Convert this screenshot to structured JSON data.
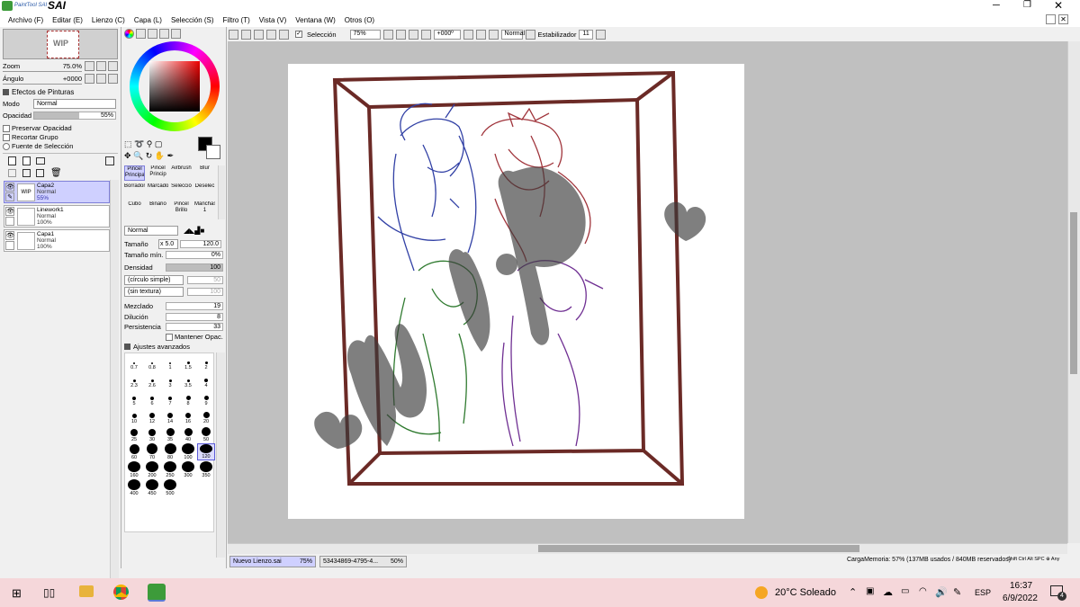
{
  "app": {
    "title": "SAI",
    "logo_text": "PaintTool SAI"
  },
  "menu": [
    "Archivo (F)",
    "Editar (E)",
    "Lienzo (C)",
    "Capa (L)",
    "Selección (S)",
    "Filtro (T)",
    "Vista (V)",
    "Ventana (W)",
    "Otros (O)"
  ],
  "toolbar": {
    "selection_label": "Selección",
    "zoom": "75%",
    "angle": "+000º",
    "blend": "Normal",
    "stabilizer_label": "Estabilizador",
    "stabilizer_value": "11"
  },
  "navigator": {
    "zoom_label": "Zoom",
    "zoom_value": "75.0%",
    "angle_label": "Ángulo",
    "angle_value": "+0000"
  },
  "paint_effects": {
    "header": "Efectos de Pinturas",
    "mode_label": "Modo",
    "mode_value": "Normal",
    "opacity_label": "Opacidad",
    "opacity_value": "55%",
    "opacity_fraction": 0.55,
    "preserve": "Preservar Opacidad",
    "clip": "Recortar Grupo",
    "source": "Fuente de Selección"
  },
  "layers": [
    {
      "name": "Capa2",
      "mode": "Normal",
      "opacity": "55%",
      "selected": true
    },
    {
      "name": "Linework1",
      "mode": "Normal",
      "opacity": "100%",
      "selected": false
    },
    {
      "name": "Capa1",
      "mode": "Normal",
      "opacity": "100%",
      "selected": false
    }
  ],
  "tools": [
    {
      "label": "Pincel Principal",
      "selected": true
    },
    {
      "label": "Pincel Princip",
      "selected": false
    },
    {
      "label": "Airbrush",
      "selected": false
    },
    {
      "label": "Blur",
      "selected": false
    },
    {
      "label": "Borrador",
      "selected": false
    },
    {
      "label": "Marcador",
      "selected": false
    },
    {
      "label": "Selecció",
      "selected": false
    },
    {
      "label": "Deselec",
      "selected": false
    },
    {
      "label": "Cubo",
      "selected": false
    },
    {
      "label": "Binario",
      "selected": false
    },
    {
      "label": "Pincel Brillo",
      "selected": false
    },
    {
      "label": "Manchas 1",
      "selected": false
    }
  ],
  "brush": {
    "mode": "Normal",
    "size_label": "Tamaño",
    "size_mult": "x 5.0",
    "size_value": "120.0",
    "min_size_label": "Tamaño mín.",
    "min_size_value": "0%",
    "density_label": "Densidad",
    "density_value": "100",
    "shape": "(círculo simple)",
    "shape_value": "50",
    "texture": "(sin textura)",
    "texture_value": "100",
    "mix_label": "Mezclado",
    "mix_value": "19",
    "dilution_label": "Dilución",
    "dilution_value": "8",
    "persistence_label": "Persistencia",
    "persistence_value": "33",
    "keep_opacity": "Mantener Opac.",
    "advanced": "Ajustes avanzados",
    "sizes": [
      "0.7",
      "0.8",
      "1",
      "1.5",
      "2",
      "2.3",
      "2.6",
      "3",
      "3.5",
      "4",
      "5",
      "6",
      "7",
      "8",
      "9",
      "10",
      "12",
      "14",
      "16",
      "20",
      "25",
      "30",
      "35",
      "40",
      "50",
      "60",
      "70",
      "80",
      "100",
      "120",
      "160",
      "200",
      "250",
      "300",
      "350",
      "400",
      "450",
      "500"
    ],
    "selected_size": "120"
  },
  "tabs": [
    {
      "name": "Nuevo Lienzo.sai",
      "zoom": "75%",
      "active": true
    },
    {
      "name": "53434869-4795-4...",
      "zoom": "50%",
      "active": false
    }
  ],
  "status": {
    "memory": "CargaMemoria: 57% (137MB usados / 840MB reservados)",
    "keys": "Shift Ctrl Alt SPC ⊕ Any"
  },
  "canvas": {
    "watermark": "WIP"
  },
  "taskbar": {
    "weather": "20°C  Soleado",
    "lang": "ESP",
    "time": "16:37",
    "date": "6/9/2022",
    "notif": "4"
  },
  "colors": {
    "accent": "#cfd0ff",
    "frame": "#6b2a26",
    "taskbar": "#f5d7da"
  }
}
